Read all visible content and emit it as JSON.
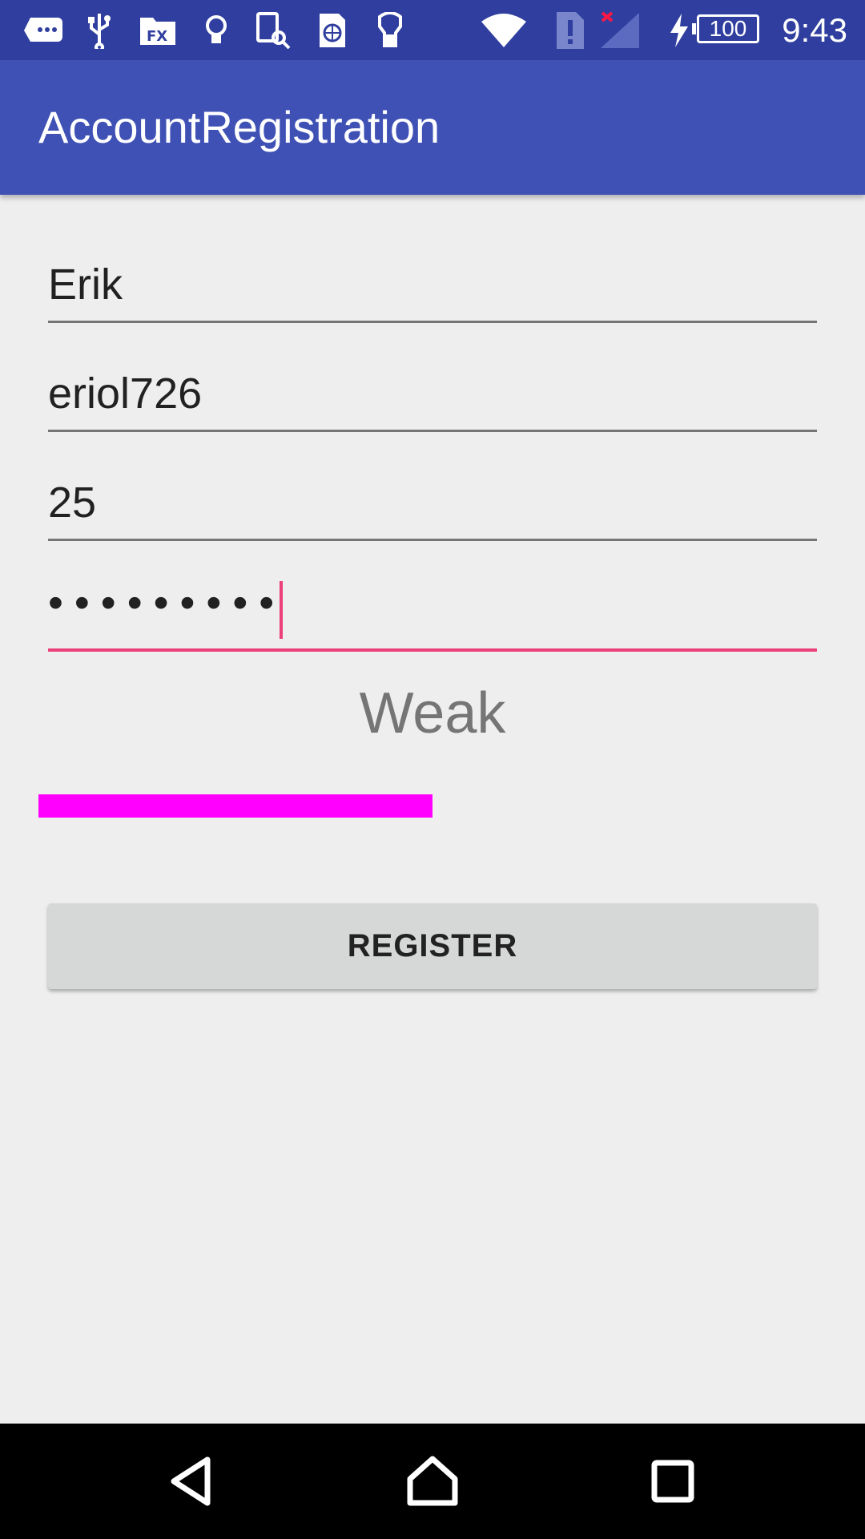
{
  "status_bar": {
    "icons": [
      "message-icon",
      "usb-icon",
      "file-icon",
      "bulb-icon",
      "tablet-search-icon",
      "sim-globe-icon",
      "flashlight-icon",
      "wifi-icon",
      "sim-alert-icon",
      "signal-no-service-icon",
      "charging-icon"
    ],
    "battery_level": "100",
    "time": "9:43"
  },
  "app_bar": {
    "title": "AccountRegistration"
  },
  "form": {
    "first_name": "Erik",
    "username": "eriol726",
    "age": "25",
    "password_dots": "•••••••••",
    "strength_label": "Weak",
    "strength_fraction": 0.5,
    "strength_color": "#ff00ff",
    "register_label": "REGISTER"
  },
  "nav_bar": {
    "icons": [
      "back-icon",
      "home-icon",
      "recents-icon"
    ]
  },
  "colors": {
    "primary": "#3f51b5",
    "primary_dark": "#303f9f",
    "accent": "#ec407a"
  }
}
